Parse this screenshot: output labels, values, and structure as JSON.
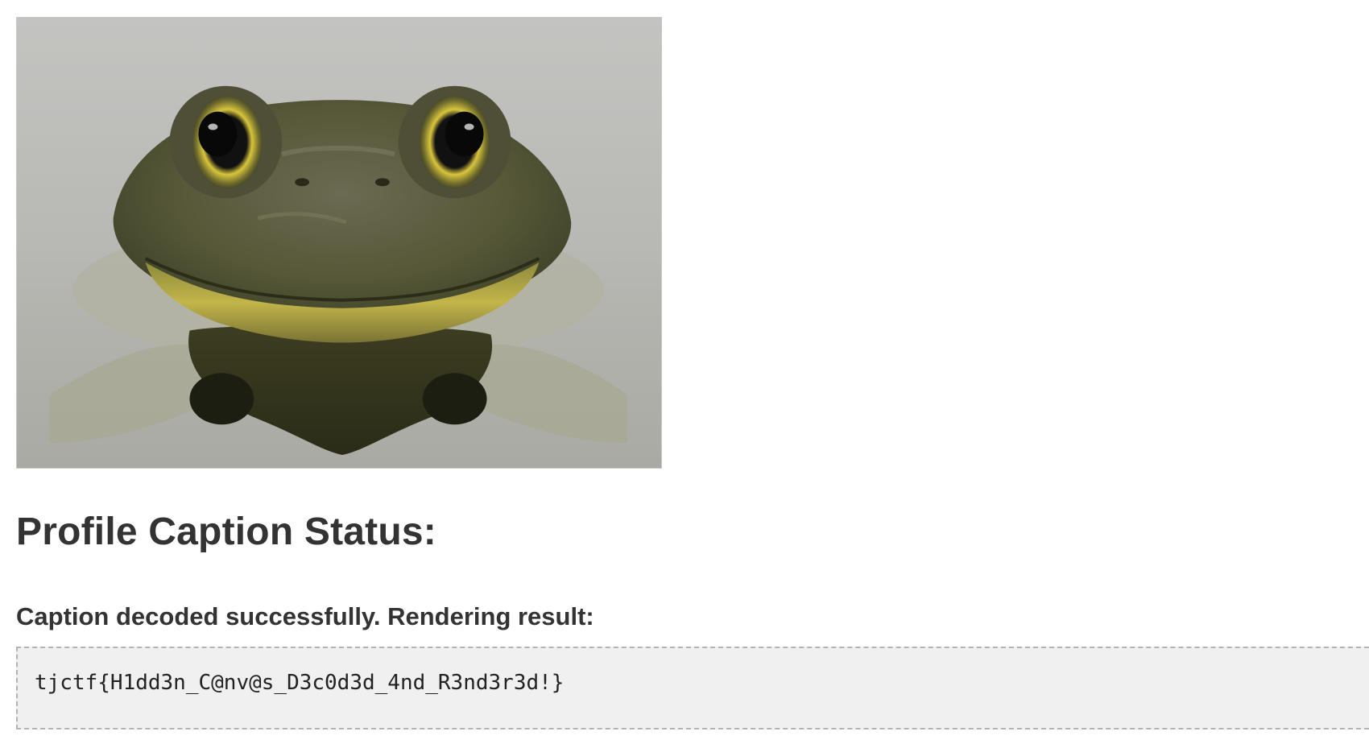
{
  "profile_image": {
    "subject": "bullfrog-photo"
  },
  "caption_status": {
    "heading": "Profile Caption Status:",
    "message": "Caption decoded successfully. Rendering result:",
    "result": "tjctf{H1dd3n_C@nv@s_D3c0d3d_4nd_R3nd3r3d!}"
  }
}
